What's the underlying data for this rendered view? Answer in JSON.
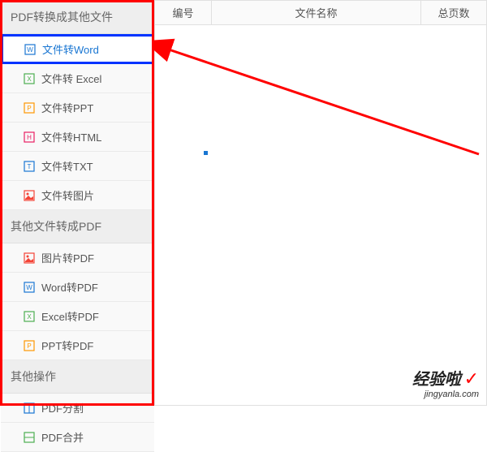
{
  "sidebar": {
    "section1_title": "PDF转换成其他文件",
    "section2_title": "其他文件转成PDF",
    "section3_title": "其他操作",
    "items1": [
      {
        "label": "文件转Word",
        "icon_color": "#1976d2"
      },
      {
        "label": "文件转 Excel",
        "icon_color": "#4caf50"
      },
      {
        "label": "文件转PPT",
        "icon_color": "#ff9800"
      },
      {
        "label": "文件转HTML",
        "icon_color": "#e91e63"
      },
      {
        "label": "文件转TXT",
        "icon_color": "#1976d2"
      },
      {
        "label": "文件转图片",
        "icon_color": "#f44336"
      }
    ],
    "items2": [
      {
        "label": "图片转PDF",
        "icon_color": "#f44336"
      },
      {
        "label": "Word转PDF",
        "icon_color": "#1976d2"
      },
      {
        "label": "Excel转PDF",
        "icon_color": "#4caf50"
      },
      {
        "label": "PPT转PDF",
        "icon_color": "#ff9800"
      }
    ],
    "items3": [
      {
        "label": "PDF分割",
        "icon_color": "#1976d2"
      },
      {
        "label": "PDF合并",
        "icon_color": "#4caf50"
      }
    ]
  },
  "table": {
    "col_num": "编号",
    "col_name": "文件名称",
    "col_pages": "总页数"
  },
  "watermark": {
    "main": "经验啦",
    "check": "✓",
    "url": "jingyanla.com"
  }
}
